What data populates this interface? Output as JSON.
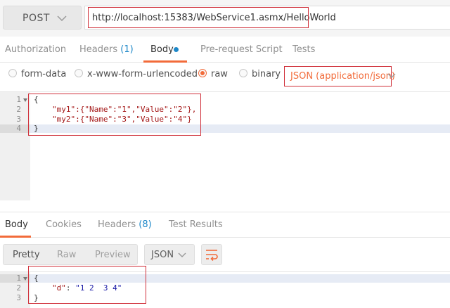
{
  "request": {
    "method": "POST",
    "url": "http://localhost:15383/WebService1.asmx/HelloWorld"
  },
  "request_tabs": [
    {
      "label": "Authorization"
    },
    {
      "label": "Headers",
      "count": "(1)"
    },
    {
      "label": "Body"
    },
    {
      "label": "Pre-request Script"
    },
    {
      "label": "Tests"
    }
  ],
  "body_modes": [
    {
      "label": "form-data",
      "selected": false
    },
    {
      "label": "x-www-form-urlencoded",
      "selected": false
    },
    {
      "label": "raw",
      "selected": true
    },
    {
      "label": "binary",
      "selected": false
    }
  ],
  "content_type": "JSON (application/json)",
  "request_body": {
    "line_numbers": [
      "1",
      "2",
      "3",
      "4"
    ],
    "line1": "{",
    "line2_key": "\"my1\"",
    "line2_rest": ":{\"Name\":\"1\",\"Value\":\"2\"},",
    "line3_key": "\"my2\"",
    "line3_rest": ":{\"Name\":\"3\",\"Value\":\"4\"}",
    "line4": "}"
  },
  "response_tabs": [
    {
      "label": "Body"
    },
    {
      "label": "Cookies"
    },
    {
      "label": "Headers",
      "count": "(8)"
    },
    {
      "label": "Test Results"
    }
  ],
  "view_modes": [
    "Pretty",
    "Raw",
    "Preview"
  ],
  "response_format": "JSON",
  "response_body": {
    "line_numbers": [
      "1",
      "2",
      "3"
    ],
    "line1": "{",
    "line2_key": "\"d\"",
    "line2_sep": ": ",
    "line2_value": "\"1 2  3 4\"",
    "line3": "}"
  },
  "colors": {
    "accent": "#f26b3a",
    "link_blue": "#1e88c9",
    "highlight_red": "#d0303a"
  }
}
